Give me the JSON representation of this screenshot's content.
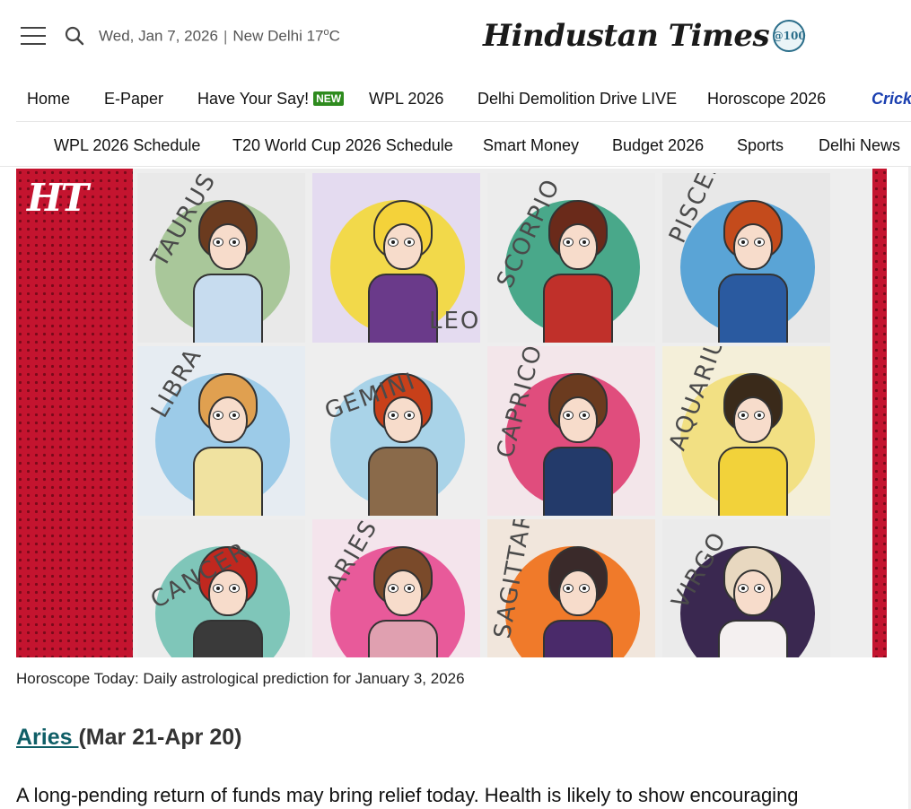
{
  "header": {
    "date": "Wed, Jan 7, 2026",
    "separator": "|",
    "city_weather": "New Delhi 17",
    "temp_unit_sup": "o",
    "temp_unit": "C",
    "logo_text": "Hindustan Times",
    "logo_seal": "@100",
    "icons": {
      "menu": "hamburger-icon",
      "search": "search-icon"
    }
  },
  "nav_primary": {
    "items": [
      "Home",
      "E-Paper",
      "Have Your Say!",
      "WPL 2026",
      "Delhi Demolition Drive LIVE",
      "Horoscope 2026",
      "Crick"
    ],
    "new_badge": "NEW"
  },
  "nav_secondary": {
    "items": [
      "WPL 2026 Schedule",
      "T20 World Cup 2026 Schedule",
      "Smart Money",
      "Budget 2026",
      "Sports",
      "Delhi News"
    ]
  },
  "hero": {
    "brand_mark": "HT",
    "signs": [
      "TAURUS",
      "LEO",
      "SCORPIO",
      "PISCES",
      "LIBRA",
      "GEMINI",
      "CAPRICORN",
      "AQUARIUS",
      "CANCER",
      "ARIES",
      "SAGITTARIUS",
      "VIRGO"
    ],
    "colors": {
      "frame": "#c4142f",
      "dots": "#7a0a1a"
    }
  },
  "caption": "Horoscope Today: Daily astrological prediction for January 3, 2026",
  "article": {
    "sign_link": "Aries ",
    "sign_dates": "(Mar 21-Apr 20)",
    "paragraph": "A long-pending return of funds may bring relief today. Health is likely to show encouraging"
  }
}
